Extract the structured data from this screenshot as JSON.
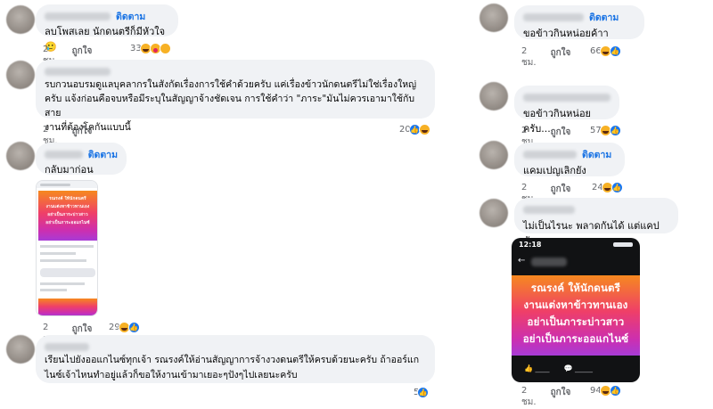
{
  "labels": {
    "follow": "ติดตาม",
    "like": "ถูกใจ"
  },
  "left": [
    {
      "time": "2 ชม.",
      "text": "ลบโพสเลย นักดนตรีก็มีหัวใจ🥲",
      "reactions": [
        "haha",
        "care",
        "sad"
      ],
      "count": "33",
      "follow": true
    },
    {
      "time": "2 ชม.",
      "text": "รบกวนอบรมดูแลบุคลากรในสังกัดเรื่องการใช้คำด้วยครับ แค่เรื่องข้าวนักดนตรีไม่ใช่เรื่องใหญ่\nครับ แจ้งก่อนคือจบหรือมีระบุในสัญญาจ้างชัดเจน การใช้คำว่า \"ภาระ\"มันไม่ควรเอามาใช้กับสาย\nงานที่ต้องโคกันแบบนี้",
      "reactions": [
        "likei",
        "haha"
      ],
      "count": "20",
      "follow": false
    },
    {
      "time": "2 ชม.",
      "text": "กลับมาก่อนนนนนน",
      "reactions": [
        "haha",
        "likei"
      ],
      "count": "29",
      "follow": true,
      "thumb_caption": "รณรงค์ ให้นักดนตรี\nงานแต่งหาข้าวทานเอง\nอย่าเป็นภาระบ่าวสาว\nอย่าเป็นภาระออแกไนซ์"
    },
    {
      "time": "2 ชม.",
      "text": "เรียนไปยังออแกไนซ์ทุกเจ้า รณรงค์ให้อ่านสัญญาการจ้างวงดนตรีให้ครบด้วยนะครับ ถ้าออร์แก\nไนซ์เจ้าไหนทำอยู่แล้วก็ขอให้งานเข้ามาเยอะๆปังๆไปเลยนะครับ",
      "reactions": [
        "likei"
      ],
      "count": "5",
      "follow": false
    }
  ],
  "right": [
    {
      "time": "2 ชม.",
      "text": "ขอข้าวกินหน่อยค้าา",
      "reactions": [
        "haha",
        "likei"
      ],
      "count": "66",
      "follow": true
    },
    {
      "time": "2 ชม.",
      "text": "ขอข้าวกินหน่อยครับ....",
      "reactions": [
        "haha",
        "likei"
      ],
      "count": "57",
      "follow": false
    },
    {
      "time": "2 ชม.",
      "text": "แคมเปญเลิกยัง",
      "reactions": [
        "haha",
        "likei"
      ],
      "count": "24",
      "follow": true
    },
    {
      "time": "2 ชม.",
      "text": "ไม่เป็นไรนะ พลาดกันได้ แต่แคปทัน",
      "reactions": [
        "haha",
        "likei"
      ],
      "count": "94",
      "follow": false,
      "phone_time": "12:18",
      "phone_caption": "รณรงค์ ให้นักดนตรี\nงานแต่งหาข้าวทานเอง\nอย่าเป็นภาระบ่าวสาว\nอย่าเป็นภาระออแกไนซ์"
    }
  ]
}
